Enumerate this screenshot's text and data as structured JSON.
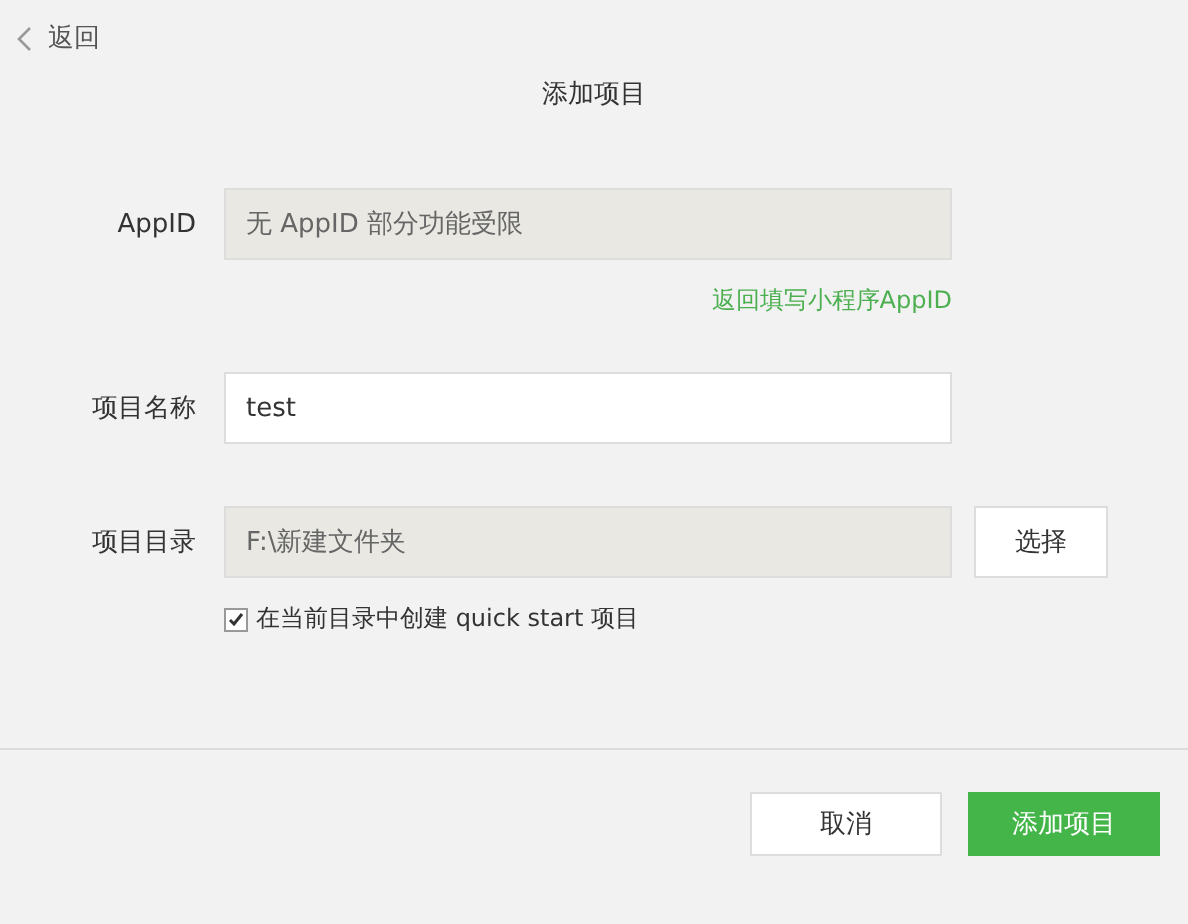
{
  "back": {
    "label": "返回"
  },
  "title": "添加项目",
  "fields": [
    {
      "kind": "readonly",
      "label": "AppID",
      "value": "无 AppID 部分功能受限",
      "link": "返回填写小程序AppID"
    },
    {
      "kind": "input",
      "label": "项目名称",
      "value": "test"
    },
    {
      "kind": "picker",
      "label": "项目目录",
      "value": "F:\\新建文件夹",
      "button": "选择"
    }
  ],
  "quickstart": {
    "label": "在当前目录中创建 quick start 项目",
    "checked": true
  },
  "buttons": [
    {
      "label": "取消",
      "primary": false
    },
    {
      "label": "添加项目",
      "primary": true
    }
  ]
}
